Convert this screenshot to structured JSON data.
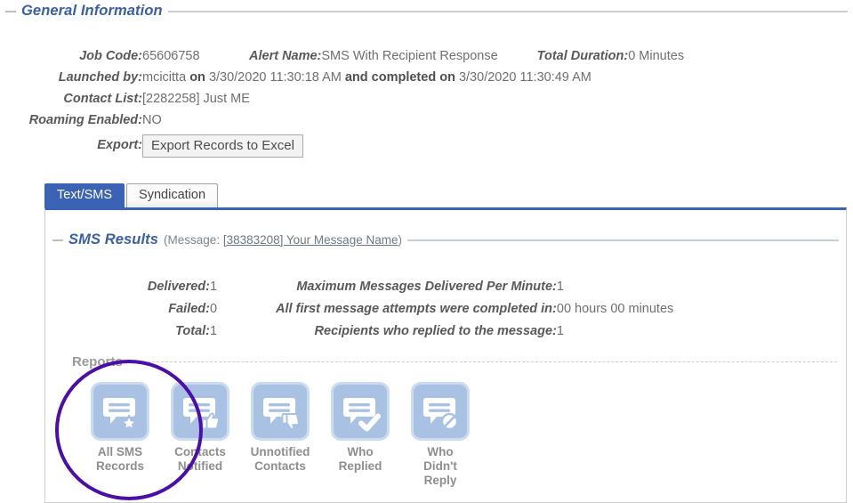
{
  "general": {
    "section_title": "General Information",
    "rows": [
      {
        "label": "Job Code:",
        "value": "65606758"
      },
      {
        "label": "Launched by:",
        "value": "mcicitta"
      },
      {
        "label": "Contact List:",
        "value": "[2282258] Just ME"
      },
      {
        "label": "Roaming Enabled:",
        "value": "NO"
      },
      {
        "label": "Export:",
        "value": ""
      }
    ],
    "job_code_label": "Job Code:",
    "job_code_value": "65606758",
    "alert_name_label": "Alert Name:",
    "alert_name_value": "SMS With Recipient Response",
    "total_duration_label": "Total Duration:",
    "total_duration_value": "0 Minutes",
    "launched_by_label": "Launched by:",
    "launched_by_user": "mcicitta",
    "launched_on_word": "on",
    "launched_on_date": "3/30/2020 11:30:18 AM",
    "completed_word": "and completed on",
    "completed_date": "3/30/2020 11:30:49 AM",
    "contact_list_label": "Contact List:",
    "contact_list_value": "[2282258] Just ME",
    "roaming_label": "Roaming Enabled:",
    "roaming_value": "NO",
    "export_label": "Export:",
    "export_button": "Export Records to Excel"
  },
  "tabs": [
    {
      "label": "Text/SMS",
      "active": true
    },
    {
      "label": "Syndication",
      "active": false
    }
  ],
  "tab_text_sms": "Text/SMS",
  "tab_syndication": "Syndication",
  "sms_results": {
    "section_title": "SMS Results",
    "message_prefix": "(Message: ",
    "message_link": "[38383208] Your Message Name",
    "message_suffix": ")",
    "delivered_label": "Delivered:",
    "delivered_value": "1",
    "failed_label": "Failed:",
    "failed_value": "0",
    "total_label": "Total:",
    "total_value": "1",
    "max_per_minute_label": "Maximum Messages Delivered Per Minute:",
    "max_per_minute_value": "1",
    "completed_in_label": "All first message attempts were completed in:",
    "completed_in_value": "00 hours 00 minutes",
    "replied_label": "Recipients who replied to the message:",
    "replied_value": "1"
  },
  "reports": {
    "label": "Reports",
    "items": [
      {
        "icon": "sms-star-icon",
        "line1": "All SMS",
        "line2": "Records"
      },
      {
        "icon": "sms-thumbs-up-icon",
        "line1": "Contacts",
        "line2": "Notified"
      },
      {
        "icon": "sms-thumbs-down-icon",
        "line1": "Unnotified",
        "line2": "Contacts"
      },
      {
        "icon": "sms-check-icon",
        "line1": "Who",
        "line2": "Replied"
      },
      {
        "icon": "sms-no-reply-icon",
        "line1": "Who Didn't",
        "line2": "Reply"
      }
    ]
  },
  "annotation": {
    "shape": "circle",
    "color": "#4b0fa8",
    "targets": "All SMS Records report icon"
  },
  "colors": {
    "accent_blue": "#3a62b5",
    "section_title": "#3b5ea8",
    "text": "#595959",
    "tile_fill": "#a9c2e3",
    "tile_border": "#ccdcf0",
    "annotation_purple": "#4b0fa8"
  }
}
